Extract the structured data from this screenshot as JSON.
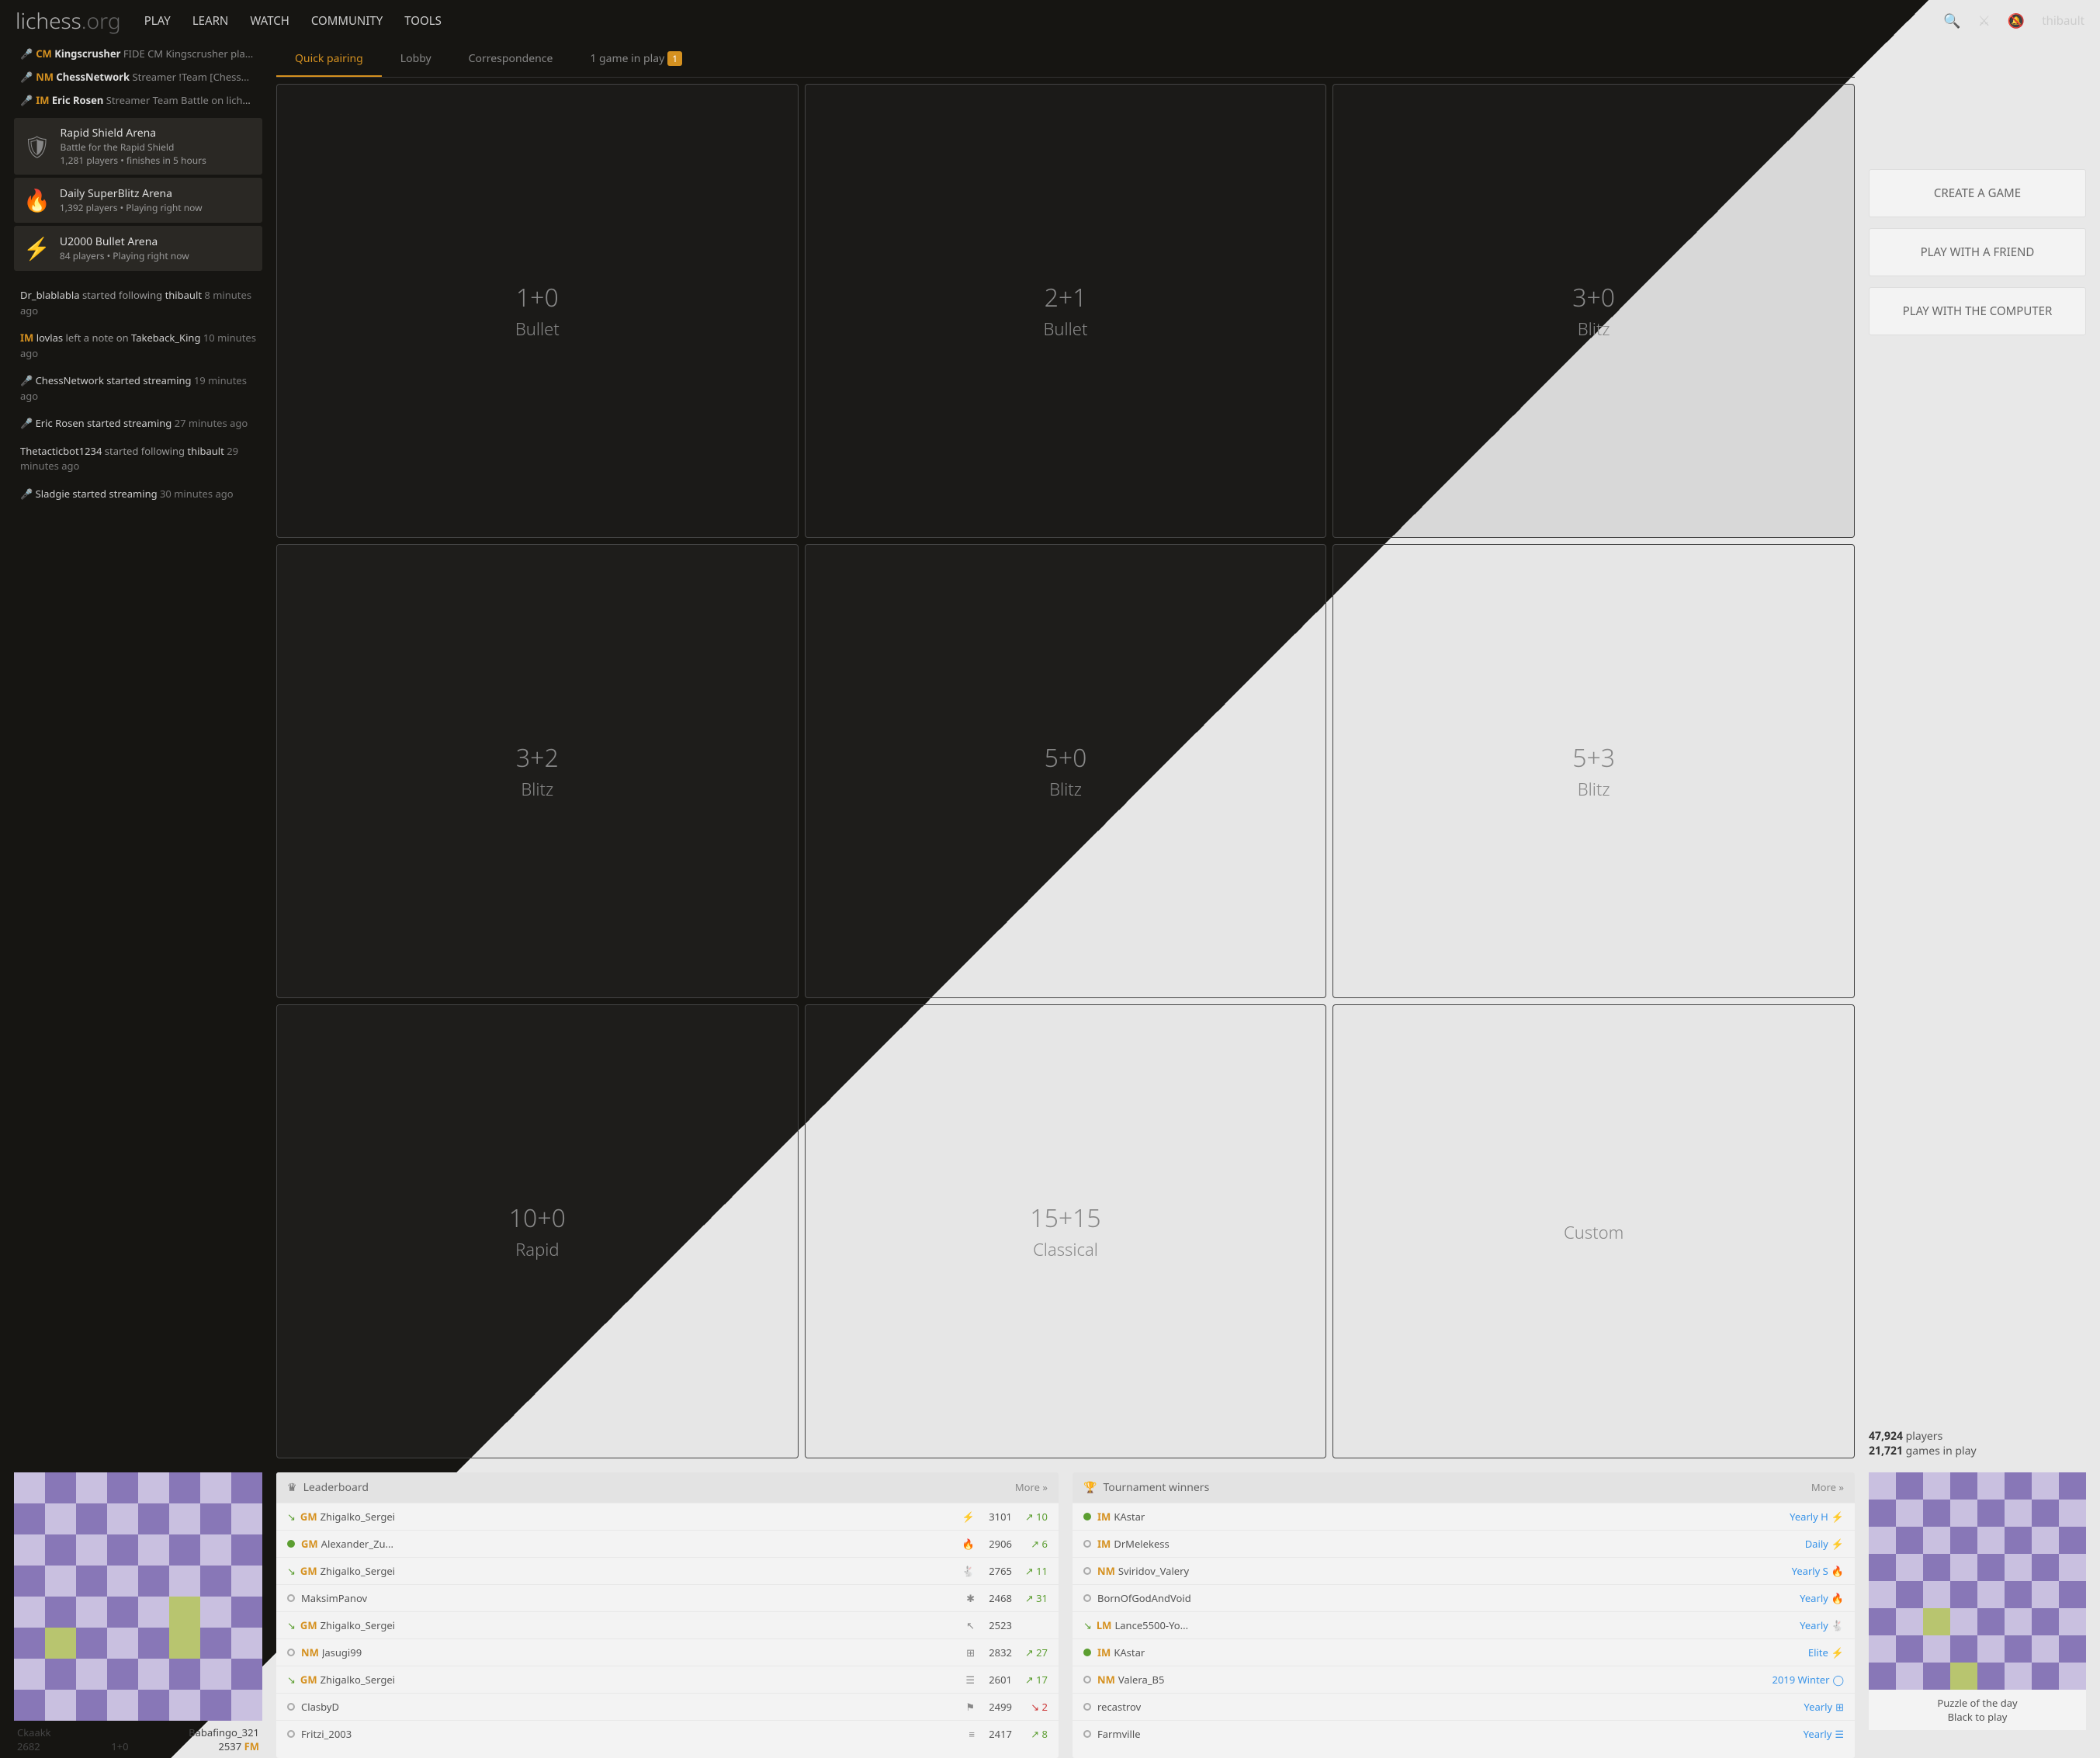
{
  "brand": {
    "name": "lichess",
    "suffix": ".org"
  },
  "nav": [
    "PLAY",
    "LEARN",
    "WATCH",
    "COMMUNITY",
    "TOOLS"
  ],
  "user": "thibault",
  "streamers": [
    {
      "title": "CM",
      "name": "Kingscrusher",
      "desc": "FIDE CM Kingscrusher pla..."
    },
    {
      "title": "NM",
      "name": "ChessNetwork",
      "desc": "Streamer !Team [Chess..."
    },
    {
      "title": "IM",
      "name": "Eric Rosen",
      "desc": "Streamer Team Battle on liche..."
    }
  ],
  "arenas": [
    {
      "icon": "🛡",
      "title": "Rapid Shield Arena",
      "sub1": "Battle for the Rapid Shield",
      "sub2": "1,281 players • finishes  in 5 hours"
    },
    {
      "icon": "🔥",
      "title": "Daily SuperBlitz Arena",
      "sub1": "1,392 players • Playing right now",
      "sub2": ""
    },
    {
      "icon": "⚡",
      "title": "U2000 Bullet Arena",
      "sub1": "84 players • Playing right now",
      "sub2": ""
    }
  ],
  "timeline": [
    {
      "pre": "",
      "title": "",
      "a": "Dr_blablabla",
      "mid": " started following ",
      "b": "thibault",
      "time": "8 minutes ago"
    },
    {
      "pre": "IM ",
      "title": "IM",
      "a": "lovlas",
      "mid": " left a note on ",
      "b": "Takeback_King",
      "time": "10 minutes ago"
    },
    {
      "pre": "🎤 ",
      "title": "",
      "a": "ChessNetwork started streaming",
      "mid": "",
      "b": "",
      "time": "19 minutes ago"
    },
    {
      "pre": "🎤 ",
      "title": "",
      "a": "Eric Rosen started streaming",
      "mid": "",
      "b": "",
      "time": "27 minutes ago"
    },
    {
      "pre": "",
      "title": "",
      "a": "Thetacticbot1234",
      "mid": " started following ",
      "b": "thibault",
      "time": "29 minutes ago"
    },
    {
      "pre": "🎤 ",
      "title": "",
      "a": "Sladgie started streaming",
      "mid": "",
      "b": "",
      "time": "30 minutes ago"
    }
  ],
  "tabs": [
    {
      "label": "Quick pairing",
      "active": true
    },
    {
      "label": "Lobby"
    },
    {
      "label": "Correspondence"
    },
    {
      "label": "1 game in play",
      "badge": "1"
    }
  ],
  "tiles": [
    {
      "tc": "1+0",
      "tn": "Bullet"
    },
    {
      "tc": "2+1",
      "tn": "Bullet"
    },
    {
      "tc": "3+0",
      "tn": "Blitz"
    },
    {
      "tc": "3+2",
      "tn": "Blitz"
    },
    {
      "tc": "5+0",
      "tn": "Blitz"
    },
    {
      "tc": "5+3",
      "tn": "Blitz"
    },
    {
      "tc": "10+0",
      "tn": "Rapid"
    },
    {
      "tc": "15+15",
      "tn": "Classical"
    },
    {
      "tc": "",
      "tn": "Custom"
    }
  ],
  "buttons": [
    "CREATE A GAME",
    "PLAY WITH A FRIEND",
    "PLAY WITH THE COMPUTER"
  ],
  "stats": {
    "players": "47,924",
    "plabel": " players",
    "games": "21,721",
    "glabel": " games in play"
  },
  "featured": {
    "white": {
      "name": "Babafingo_321",
      "rating": "2537",
      "title": "FM"
    },
    "black": {
      "name": "Ckaakk",
      "rating": "2682"
    },
    "clock": "1+0"
  },
  "leaderboard": {
    "title": "Leaderboard",
    "more": "More »",
    "rows": [
      {
        "wing": true,
        "on": false,
        "title": "GM",
        "name": "Zhigalko_Sergei",
        "icon": "⚡",
        "rating": "3101",
        "delta": "↗ 10",
        "neg": false
      },
      {
        "wing": false,
        "on": true,
        "title": "GM",
        "name": "Alexander_Zu...",
        "icon": "🔥",
        "rating": "2906",
        "delta": "↗ 6",
        "neg": false
      },
      {
        "wing": true,
        "on": false,
        "title": "GM",
        "name": "Zhigalko_Sergei",
        "icon": "🐇",
        "rating": "2765",
        "delta": "↗ 11",
        "neg": false
      },
      {
        "wing": false,
        "on": false,
        "title": "",
        "name": "MaksimPanov",
        "icon": "✱",
        "rating": "2468",
        "delta": "↗ 31",
        "neg": false
      },
      {
        "wing": true,
        "on": false,
        "title": "GM",
        "name": "Zhigalko_Sergei",
        "icon": "↖",
        "rating": "2523",
        "delta": "",
        "neg": false
      },
      {
        "wing": false,
        "on": false,
        "title": "NM",
        "name": "Jasugi99",
        "icon": "⊞",
        "rating": "2832",
        "delta": "↗ 27",
        "neg": false
      },
      {
        "wing": true,
        "on": false,
        "title": "GM",
        "name": "Zhigalko_Sergei",
        "icon": "☰",
        "rating": "2601",
        "delta": "↗ 17",
        "neg": false
      },
      {
        "wing": false,
        "on": false,
        "title": "",
        "name": "ClasbyD",
        "icon": "⚑",
        "rating": "2499",
        "delta": "↘ 2",
        "neg": true
      },
      {
        "wing": false,
        "on": false,
        "title": "",
        "name": "Fritzi_2003",
        "icon": "≡",
        "rating": "2417",
        "delta": "↗ 8",
        "neg": false
      }
    ]
  },
  "winners": {
    "title": "Tournament winners",
    "more": "More »",
    "rows": [
      {
        "on": true,
        "title": "IM",
        "name": "KAstar",
        "link": "Yearly H",
        "icon": "⚡"
      },
      {
        "on": false,
        "title": "IM",
        "name": "DrMelekess",
        "link": "Daily",
        "icon": "⚡"
      },
      {
        "on": false,
        "title": "NM",
        "name": "Sviridov_Valery",
        "link": "Yearly S",
        "icon": "🔥"
      },
      {
        "on": false,
        "title": "",
        "name": "BornOfGodAndVoid",
        "link": "Yearly",
        "icon": "🔥"
      },
      {
        "on": false,
        "wing": true,
        "title": "LM",
        "name": "Lance5500-Yo...",
        "link": "Yearly",
        "icon": "🐇"
      },
      {
        "on": true,
        "title": "IM",
        "name": "KAstar",
        "link": "Elite",
        "icon": "⚡"
      },
      {
        "on": false,
        "title": "NM",
        "name": "Valera_B5",
        "link": "2019 Winter",
        "icon": "◯"
      },
      {
        "on": false,
        "title": "",
        "name": "recastrov",
        "link": "Yearly",
        "icon": "⊞"
      },
      {
        "on": false,
        "title": "",
        "name": "Farmville",
        "link": "Yearly",
        "icon": "☰"
      }
    ]
  },
  "puzzle": {
    "title": "Puzzle of the day",
    "sub": "Black to play"
  }
}
